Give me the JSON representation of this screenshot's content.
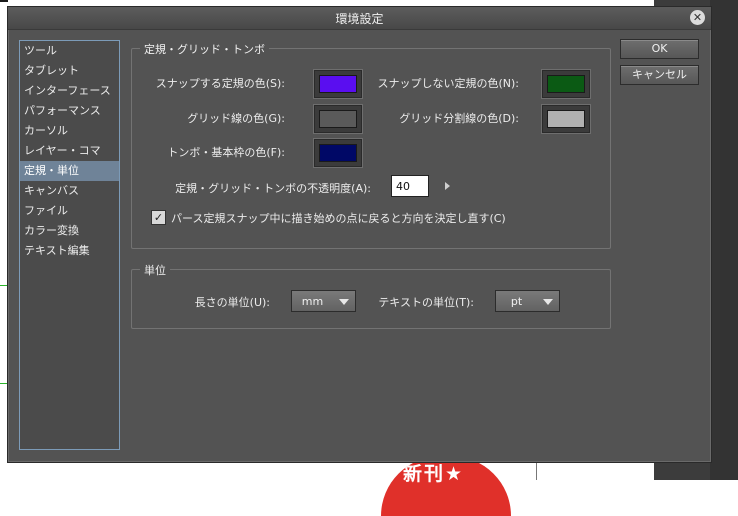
{
  "dialog": {
    "title": "環境設定",
    "close_icon": "close-icon"
  },
  "categories": [
    {
      "label": "ツール"
    },
    {
      "label": "タブレット"
    },
    {
      "label": "インターフェース"
    },
    {
      "label": "パフォーマンス"
    },
    {
      "label": "カーソル"
    },
    {
      "label": "レイヤー・コマ"
    },
    {
      "label": "定規・単位",
      "selected": true
    },
    {
      "label": "キャンバス"
    },
    {
      "label": "ファイル"
    },
    {
      "label": "カラー変換"
    },
    {
      "label": "テキスト編集"
    }
  ],
  "ruler_group": {
    "title": "定規・グリッド・トンボ",
    "snap_color_label": "スナップする定規の色(S):",
    "snap_color": "#5a0ef0",
    "nosnap_color_label": "スナップしない定規の色(N):",
    "nosnap_color": "#0b5a14",
    "grid_color_label": "グリッド線の色(G):",
    "grid_color": "#5a5a5a",
    "grid_div_color_label": "グリッド分割線の色(D):",
    "grid_div_color": "#b0b0b0",
    "trim_color_label": "トンボ・基本枠の色(F):",
    "trim_color": "#000866",
    "opacity_label": "定規・グリッド・トンボの不透明度(A):",
    "opacity_value": "40",
    "perspective_checkbox_label": "パース定規スナップ中に描き始めの点に戻ると方向を決定し直す(C)",
    "perspective_checked": true
  },
  "unit_group": {
    "title": "単位",
    "length_unit_label": "長さの単位(U):",
    "length_unit_value": "mm",
    "text_unit_label": "テキストの単位(T):",
    "text_unit_value": "pt"
  },
  "buttons": {
    "ok": "OK",
    "cancel": "キャンセル"
  },
  "background": {
    "badge_text": "新刊★"
  }
}
